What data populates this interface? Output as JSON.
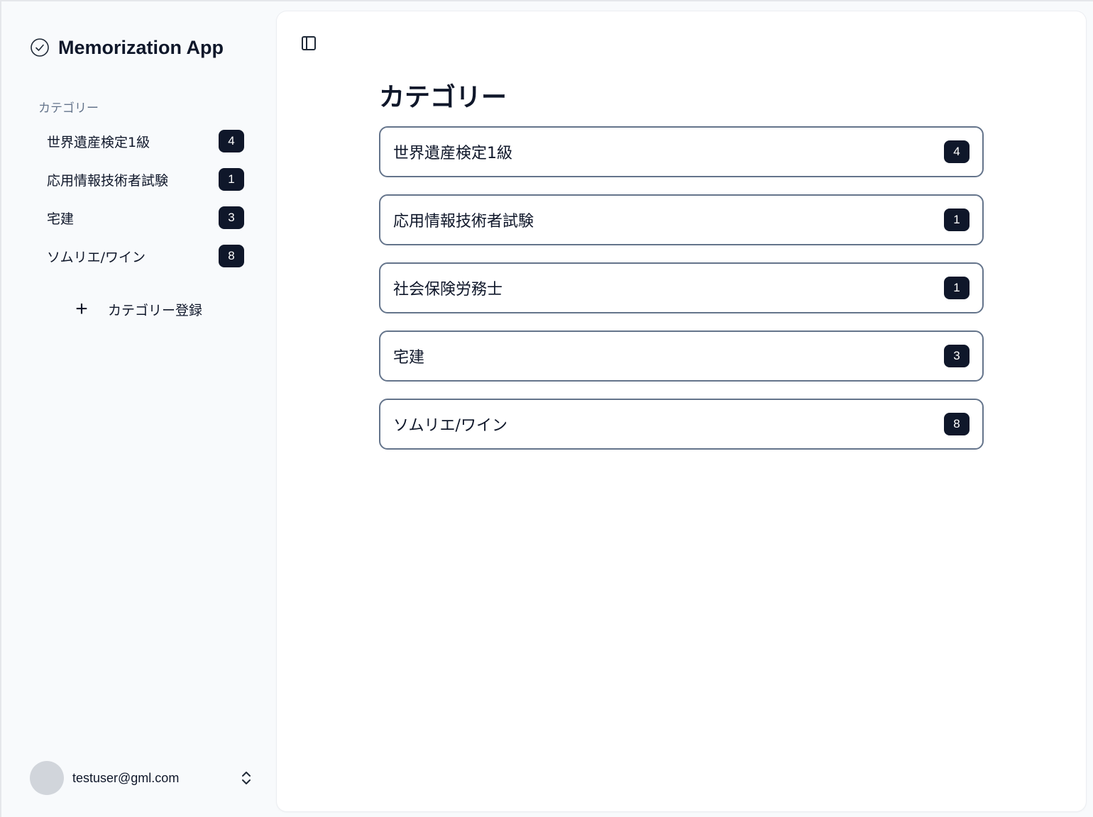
{
  "app": {
    "title": "Memorization App"
  },
  "sidebar": {
    "section_label": "カテゴリー",
    "items": [
      {
        "label": "世界遺産検定1級",
        "count": "4"
      },
      {
        "label": "応用情報技術者試験",
        "count": "1"
      },
      {
        "label": "宅建",
        "count": "3"
      },
      {
        "label": "ソムリエ/ワイン",
        "count": "8"
      }
    ],
    "add_button_label": "カテゴリー登録"
  },
  "user": {
    "email": "testuser@gml.com"
  },
  "main": {
    "title": "カテゴリー",
    "categories": [
      {
        "label": "世界遺産検定1級",
        "count": "4"
      },
      {
        "label": "応用情報技術者試験",
        "count": "1"
      },
      {
        "label": "社会保険労務士",
        "count": "1"
      },
      {
        "label": "宅建",
        "count": "3"
      },
      {
        "label": "ソムリエ/ワイン",
        "count": "8"
      }
    ]
  },
  "colors": {
    "badge_bg": "#0f172a",
    "sidebar_bg": "#f8fafc",
    "card_border": "#64748b"
  },
  "icons": {
    "brand": "check-circle-icon",
    "toggle": "sidebar-toggle-icon",
    "add": "plus-icon",
    "user_menu": "chevron-up-down-icon"
  }
}
